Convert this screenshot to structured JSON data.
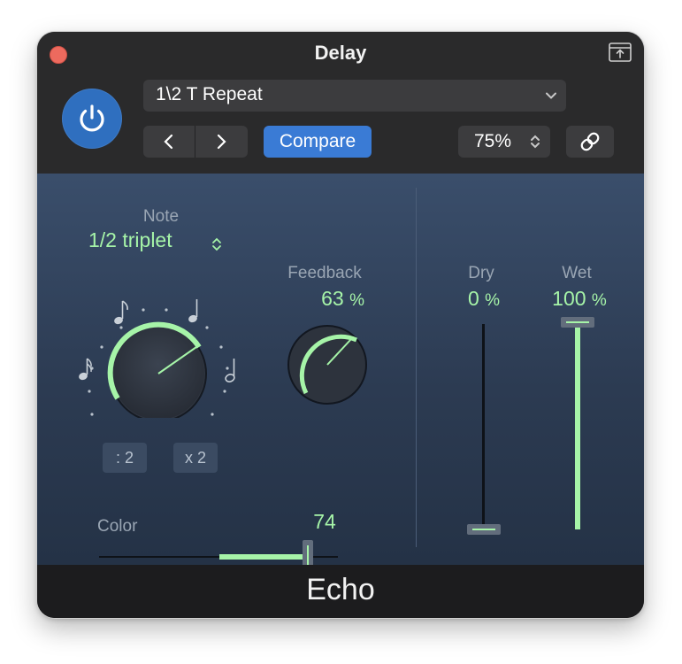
{
  "window": {
    "title": "Delay",
    "preset": "1\\2 T Repeat",
    "compare_label": "Compare",
    "zoom": "75%",
    "footer": "Echo"
  },
  "note": {
    "label": "Note",
    "value": "1/2 triplet",
    "divide_label": ": 2",
    "multiply_label": "x 2"
  },
  "feedback": {
    "label": "Feedback",
    "value": "63",
    "unit": "%"
  },
  "dry": {
    "label": "Dry",
    "value": "0",
    "unit": "%"
  },
  "wet": {
    "label": "Wet",
    "value": "100",
    "unit": "%"
  },
  "color": {
    "label": "Color",
    "value": "74"
  },
  "colors": {
    "accent_green": "#a6f4a8",
    "power_blue": "#2f6fbf",
    "compare_blue": "#3a7bd5",
    "close_red": "#ed6a5e"
  },
  "icons": [
    "close-icon",
    "expand-icon",
    "power-icon",
    "chevron-down-icon",
    "chevron-left-icon",
    "chevron-right-icon",
    "stepper-icon",
    "link-icon",
    "note-icon"
  ]
}
